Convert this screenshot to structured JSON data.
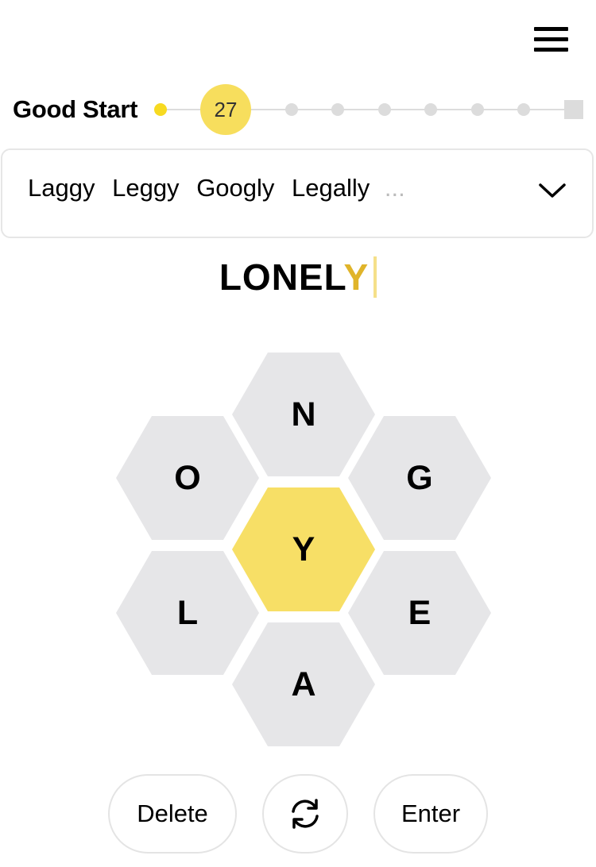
{
  "header": {
    "menu_icon": "hamburger-menu-icon"
  },
  "progress": {
    "rank": "Good Start",
    "score": "27",
    "reached_color": "#f7da21",
    "unreached_color": "#dcdcdc"
  },
  "found_words": {
    "words": [
      "Laggy",
      "Leggy",
      "Googly",
      "Legally"
    ],
    "overflow": "...",
    "expand_icon": "chevron-down-icon"
  },
  "input": {
    "typed": "LONEL",
    "center_letter": "Y"
  },
  "hive": {
    "center": "Y",
    "top": "N",
    "upper_left": "O",
    "upper_right": "G",
    "lower_left": "L",
    "lower_right": "E",
    "bottom": "A",
    "center_color": "#f7df66",
    "outer_color": "#e6e6e8"
  },
  "controls": {
    "delete": "Delete",
    "shuffle_icon": "shuffle-refresh-icon",
    "enter": "Enter"
  }
}
